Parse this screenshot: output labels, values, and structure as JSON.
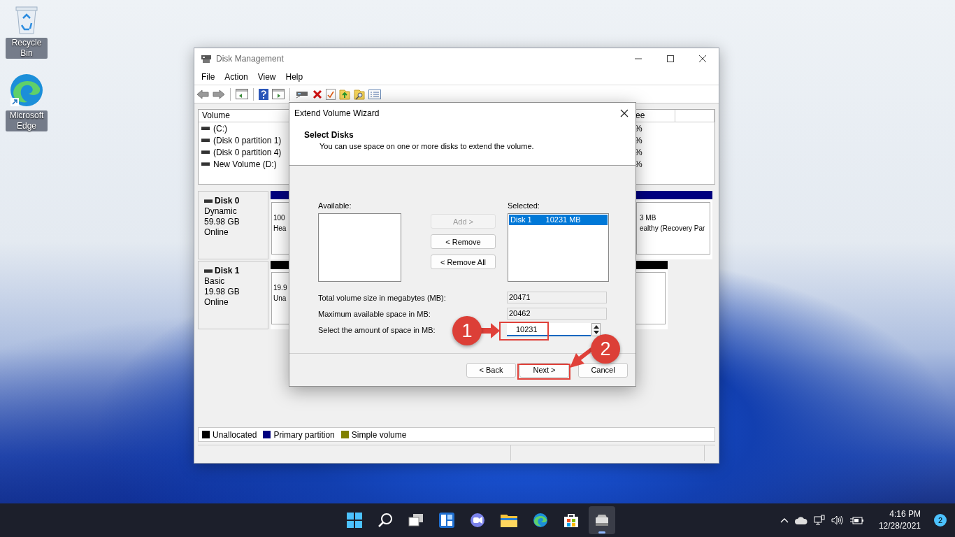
{
  "desktop": {
    "icons": [
      {
        "kind": "recycle",
        "label": "Recycle Bin"
      },
      {
        "kind": "edge",
        "label": "Microsoft Edge"
      }
    ]
  },
  "window": {
    "title": "Disk Management",
    "menu": [
      "File",
      "Action",
      "View",
      "Help"
    ],
    "volume_list": {
      "columns": [
        {
          "label": "Volume"
        },
        {
          "label": "ee"
        }
      ],
      "rows": [
        {
          "volume": "(C:)",
          "column_2": "%"
        },
        {
          "volume": "(Disk 0 partition 1)",
          "column_2": "%"
        },
        {
          "volume": "(Disk 0 partition 4)",
          "column_2": "%"
        },
        {
          "volume": "New Volume (D:)",
          "column_2": "%"
        }
      ]
    },
    "disks": [
      {
        "name": "Disk 0",
        "type": "Dynamic",
        "size": "59.98 GB",
        "status": "Online",
        "partitions": [
          {
            "color": "#00007f",
            "lines": [
              "100",
              "Hea"
            ]
          },
          {
            "color": "#00007f",
            "lines": [
              "3 MB",
              "ealthy (Recovery Par"
            ]
          }
        ]
      },
      {
        "name": "Disk 1",
        "type": "Basic",
        "size": "19.98 GB",
        "status": "Online",
        "partitions": [
          {
            "color": "#000000",
            "lines": [
              "19.9",
              "Una"
            ]
          }
        ]
      }
    ],
    "legend": [
      {
        "label": "Unallocated",
        "color": "#000000"
      },
      {
        "label": "Primary partition",
        "color": "#00007f"
      },
      {
        "label": "Simple volume",
        "color": "#808000"
      }
    ]
  },
  "dialog": {
    "title": "Extend Volume Wizard",
    "heading": "Select Disks",
    "subtitle": "You can use space on one or more disks to extend the volume.",
    "available": {
      "label": "Available:"
    },
    "selected": {
      "label": "Selected:",
      "items": [
        {
          "disk": "Disk 1",
          "size": "10231 MB",
          "selected": true
        }
      ]
    },
    "move_buttons": [
      {
        "label": "Add >",
        "disabled": true
      },
      {
        "label": "< Remove",
        "disabled": false
      },
      {
        "label": "< Remove All",
        "disabled": false
      }
    ],
    "fields": [
      {
        "kind": "readonly",
        "label": "Total volume size in megabytes (MB):",
        "value": "20471"
      },
      {
        "kind": "readonly",
        "label": "Maximum available space in MB:",
        "value": "20462"
      },
      {
        "kind": "spin",
        "label": "Select the amount of space in MB:",
        "value": "10231"
      }
    ],
    "buttons": [
      {
        "label": "< Back"
      },
      {
        "label": "Next >"
      },
      {
        "label": "Cancel"
      }
    ]
  },
  "annotations": [
    {
      "label": "1"
    },
    {
      "label": "2"
    }
  ],
  "taskbar": {
    "time": "4:16 PM",
    "date": "12/28/2021",
    "notifications": "2"
  }
}
